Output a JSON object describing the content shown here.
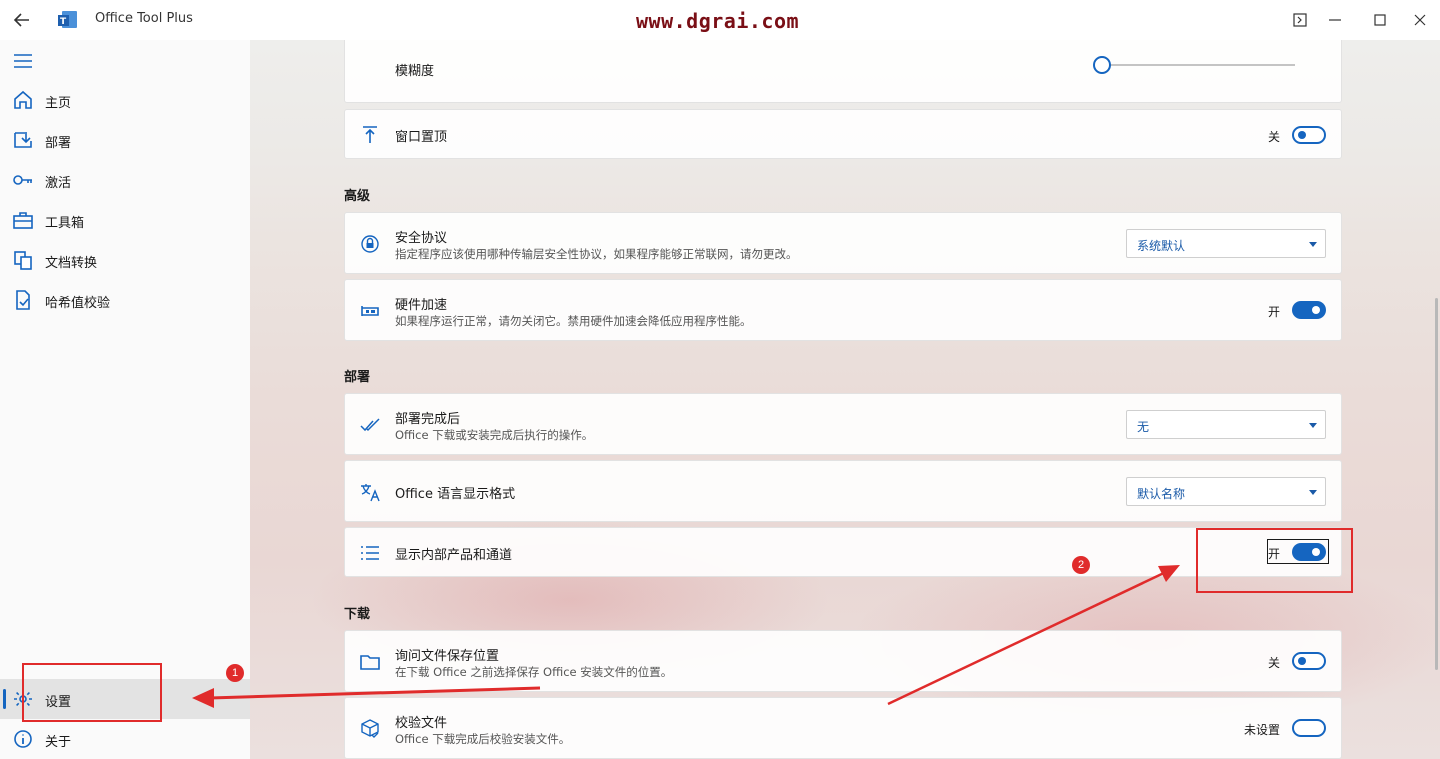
{
  "titlebar": {
    "app_title": "Office Tool Plus",
    "watermark": "www.dgrai.com"
  },
  "sidebar": {
    "items": [
      {
        "label": "主页",
        "icon": "home-icon"
      },
      {
        "label": "部署",
        "icon": "deploy-icon"
      },
      {
        "label": "激活",
        "icon": "key-icon"
      },
      {
        "label": "工具箱",
        "icon": "toolbox-icon"
      },
      {
        "label": "文档转换",
        "icon": "convert-icon"
      },
      {
        "label": "哈希值校验",
        "icon": "hash-icon"
      }
    ],
    "bottom_items": [
      {
        "label": "设置",
        "icon": "gear-icon",
        "active": true
      },
      {
        "label": "关于",
        "icon": "info-icon"
      }
    ]
  },
  "settings": {
    "blur": {
      "title": "模糊度",
      "value_fraction": 0.0
    },
    "topmost": {
      "title": "窗口置顶",
      "toggle_label": "关",
      "on": false
    },
    "section_advanced": "高级",
    "security": {
      "title": "安全协议",
      "desc": "指定程序应该使用哪种传输层安全性协议，如果程序能够正常联网，请勿更改。",
      "value": "系统默认"
    },
    "hwaccel": {
      "title": "硬件加速",
      "desc": "如果程序运行正常，请勿关闭它。禁用硬件加速会降低应用程序性能。",
      "toggle_label": "开",
      "on": true
    },
    "section_deploy": "部署",
    "after_deploy": {
      "title": "部署完成后",
      "desc": "Office 下载或安装完成后执行的操作。",
      "value": "无"
    },
    "lang_format": {
      "title": "Office 语言显示格式",
      "value": "默认名称"
    },
    "internal": {
      "title": "显示内部产品和通道",
      "toggle_label": "开",
      "on": true
    },
    "section_download": "下载",
    "ask_location": {
      "title": "询问文件保存位置",
      "desc": "在下载 Office 之前选择保存 Office 安装文件的位置。",
      "toggle_label": "关",
      "on": false
    },
    "verify": {
      "title": "校验文件",
      "desc": "Office 下载完成后校验安装文件。",
      "toggle_label": "未设置",
      "on": false
    }
  },
  "annotations": {
    "marker1": "1",
    "marker2": "2",
    "color": "#e02b2b"
  },
  "colors": {
    "accent": "#1565c0",
    "watermark": "#7a0f16"
  }
}
